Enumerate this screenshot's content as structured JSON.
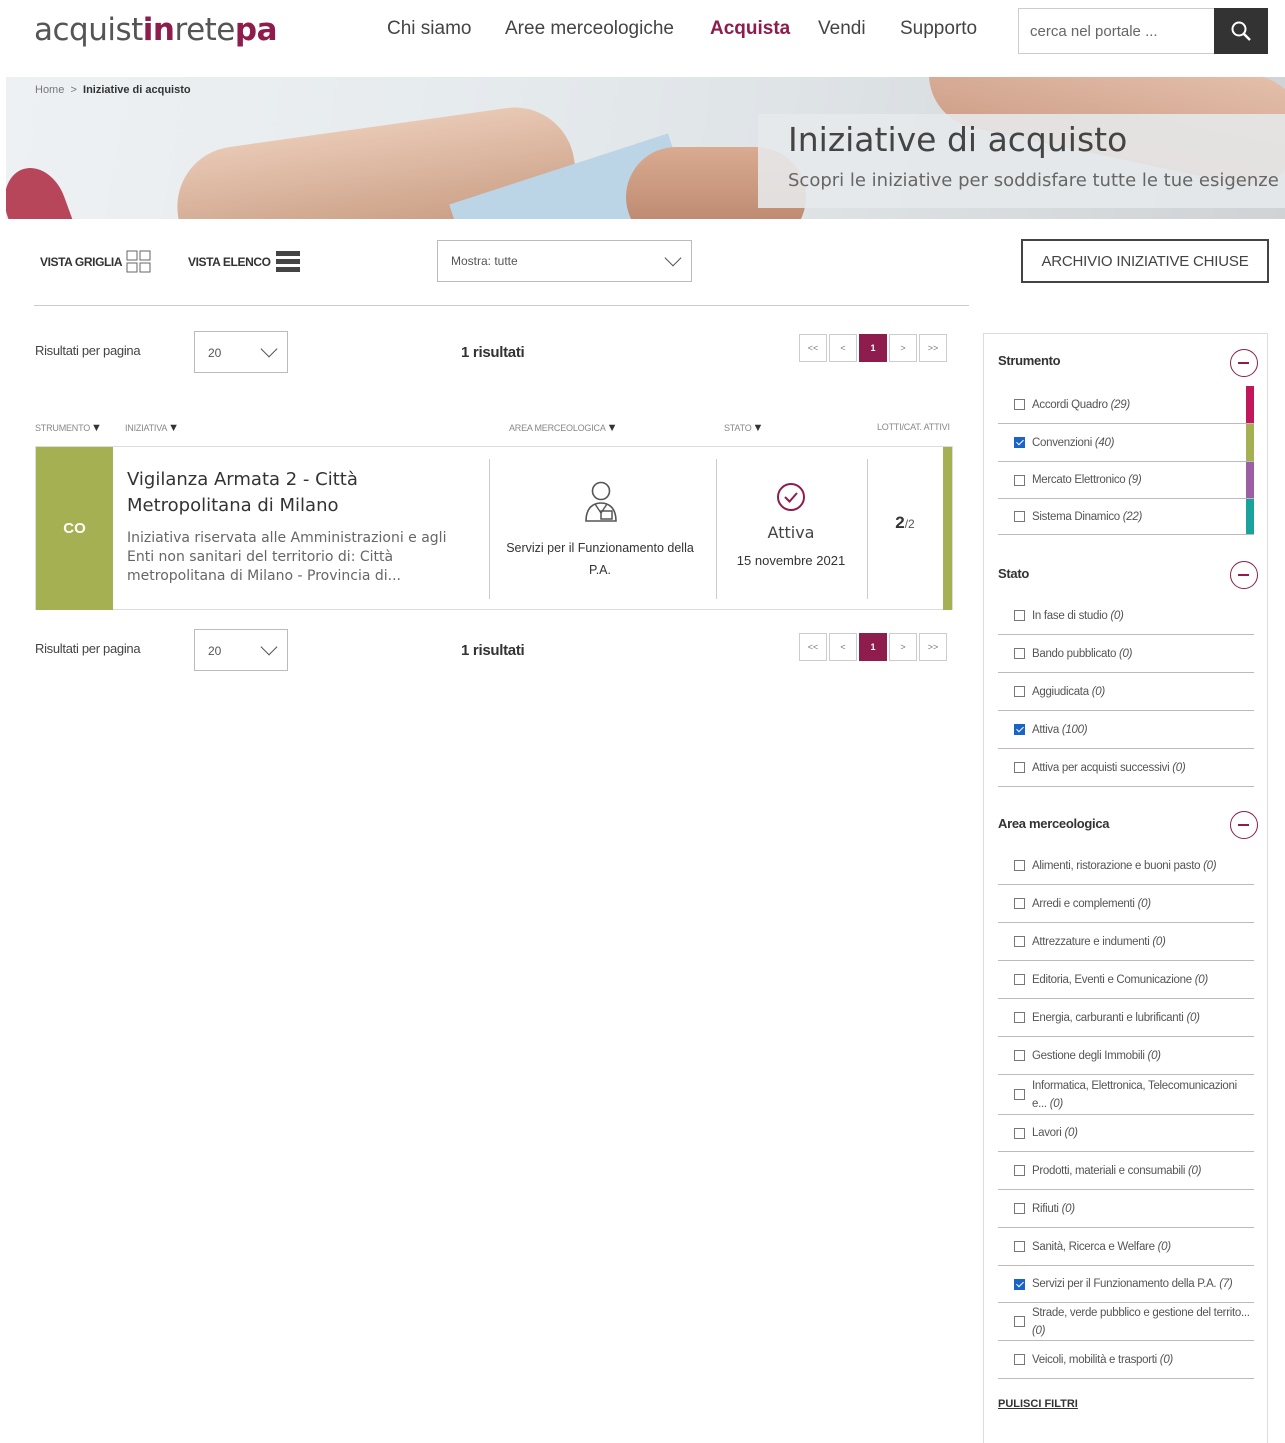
{
  "logo": {
    "p1": "acquist",
    "p2": "in",
    "p3": "rete",
    "p4": "pa"
  },
  "nav": [
    "Chi siamo",
    "Aree merceologiche",
    "Acquista",
    "Vendi",
    "Supporto"
  ],
  "search": {
    "placeholder": "cerca nel portale ..."
  },
  "breadcrumb": {
    "home": "Home",
    "sep": ">",
    "current": "Iniziative di acquisto"
  },
  "hero": {
    "title": "Iniziative di acquisto",
    "subtitle": "Scopri le iniziative per soddisfare tutte le tue esigenze"
  },
  "toolbar": {
    "grid": "VISTA GRIGLIA",
    "list": "VISTA ELENCO",
    "filter": "Mostra: tutte",
    "archive": "ARCHIVIO INIZIATIVE CHIUSE"
  },
  "results": {
    "per_page_label": "Risultati per pagina",
    "per_page_value": "20",
    "count": "1 risultati",
    "pages": [
      "<<",
      "<",
      "1",
      ">",
      ">>"
    ]
  },
  "columns": [
    "STRUMENTO",
    "INIZIATIVA",
    "AREA MERCEOLOGICA",
    "STATO",
    "LOTTI/CAT. ATTIVI"
  ],
  "row": {
    "tag": "CO",
    "title": "Vigilanza Armata 2 - Città Metropolitana di Milano",
    "desc": "Iniziativa riservata alle Amministrazioni e agli Enti non sanitari del territorio di: Città metropolitana di Milano - Provincia di...",
    "area": "Servizi per il Funzionamento della P.A.",
    "status": "Attiva",
    "date": "15 novembre 2021",
    "lots": "2",
    "lots_total": "/2",
    "color": "#a5b052"
  },
  "filters": {
    "strumento": {
      "title": "Strumento",
      "items": [
        {
          "label": "Accordi Quadro",
          "count": "(29)",
          "checked": false,
          "color": "#c2185b"
        },
        {
          "label": "Convenzioni",
          "count": "(40)",
          "checked": true,
          "color": "#a5b052"
        },
        {
          "label": "Mercato Elettronico",
          "count": "(9)",
          "checked": false,
          "color": "#9c5fa5"
        },
        {
          "label": "Sistema Dinamico",
          "count": "(22)",
          "checked": false,
          "color": "#1aa39c"
        }
      ]
    },
    "stato": {
      "title": "Stato",
      "items": [
        {
          "label": "In fase di studio",
          "count": "(0)",
          "checked": false
        },
        {
          "label": "Bando pubblicato",
          "count": "(0)",
          "checked": false
        },
        {
          "label": "Aggiudicata",
          "count": "(0)",
          "checked": false
        },
        {
          "label": "Attiva",
          "count": "(100)",
          "checked": true
        },
        {
          "label": "Attiva per acquisti successivi",
          "count": "(0)",
          "checked": false
        }
      ]
    },
    "area": {
      "title": "Area merceologica",
      "items": [
        {
          "label": "Alimenti, ristorazione e buoni pasto",
          "count": "(0)",
          "checked": false
        },
        {
          "label": "Arredi e complementi",
          "count": "(0)",
          "checked": false
        },
        {
          "label": "Attrezzature e indumenti",
          "count": "(0)",
          "checked": false
        },
        {
          "label": "Editoria, Eventi e Comunicazione",
          "count": "(0)",
          "checked": false
        },
        {
          "label": "Energia, carburanti e lubrificanti",
          "count": "(0)",
          "checked": false
        },
        {
          "label": "Gestione degli Immobili",
          "count": "(0)",
          "checked": false
        },
        {
          "label": "Informatica, Elettronica, Telecomunicazioni e...",
          "count": "(0)",
          "checked": false
        },
        {
          "label": "Lavori",
          "count": "(0)",
          "checked": false
        },
        {
          "label": "Prodotti, materiali e consumabili",
          "count": "(0)",
          "checked": false
        },
        {
          "label": "Rifiuti",
          "count": "(0)",
          "checked": false
        },
        {
          "label": "Sanità, Ricerca e Welfare",
          "count": "(0)",
          "checked": false
        },
        {
          "label": "Servizi per il Funzionamento della P.A.",
          "count": "(7)",
          "checked": true
        },
        {
          "label": "Strade, verde pubblico e gestione del territo...",
          "count": "(0)",
          "checked": false
        },
        {
          "label": "Veicoli, mobilità e trasporti",
          "count": "(0)",
          "checked": false
        }
      ]
    },
    "clear": "PULISCI FILTRI"
  }
}
